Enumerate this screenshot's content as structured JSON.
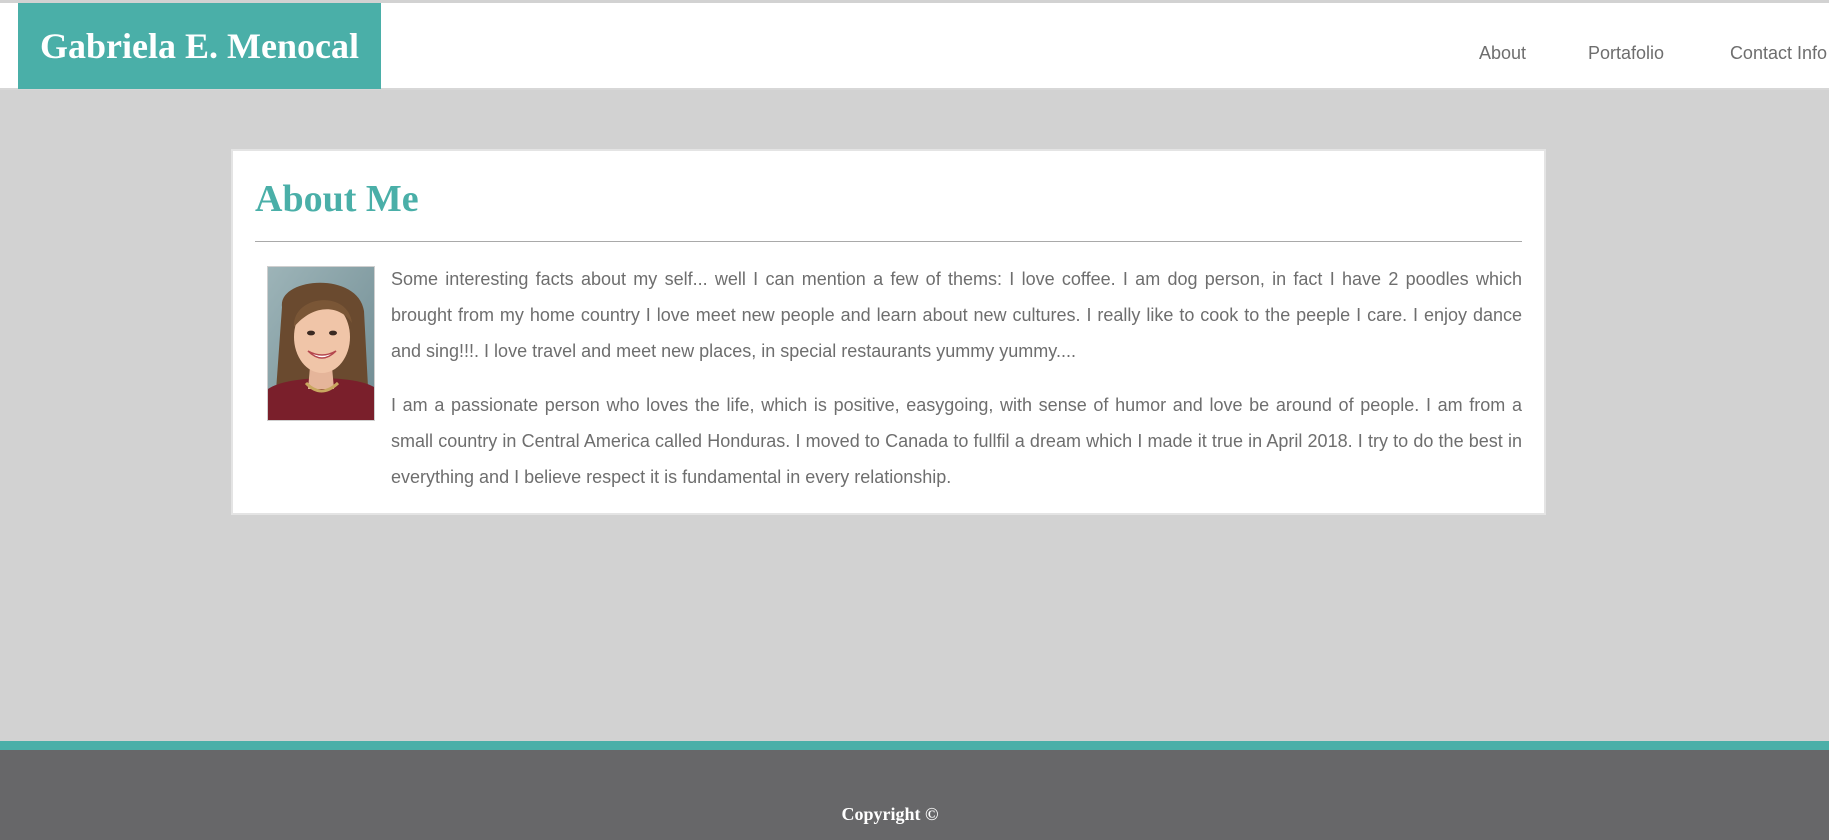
{
  "header": {
    "brand": "Gabriela E. Menocal",
    "nav": {
      "about": "About",
      "portafolio": "Portafolio",
      "contact": "Contact Info"
    }
  },
  "about": {
    "title": "About Me",
    "photo_icon": "profile-photo",
    "paragraphs": [
      "Some interesting facts about my self... well I can mention a few of thems: I love coffee. I am dog person, in fact I have 2 poodles which brought from my home country I love meet new people and learn about new cultures. I really like to cook to the peeple I care. I enjoy dance and sing!!!. I love travel and meet new places, in special restaurants yummy yummy....",
      "I am a passionate person who loves the life, which is positive, easygoing, with sense of humor and love be around of people. I am from a small country in Central America called Honduras. I moved to Canada to fullfil a dream which I made it true in April 2018. I try to do the best in everything and I believe respect it is fundamental in every relationship."
    ]
  },
  "footer": {
    "copyright": "Copyright ©"
  },
  "colors": {
    "accent": "#4aafa8",
    "background": "#d2d2d2",
    "footer": "#676769",
    "text": "#6e6e6e"
  }
}
